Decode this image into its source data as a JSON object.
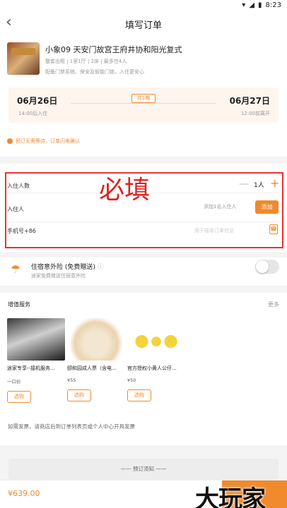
{
  "status": {
    "time": "8:23"
  },
  "nav": {
    "title": "填写订单"
  },
  "hotel": {
    "name": "小象09 天安门故宫王府井协和阳光复式",
    "sub": "整套出租 | 1室1厅 | 2床 | 最多住4人",
    "desc": "配备门禁系统、保安及智能门锁，入住更安心"
  },
  "dates": {
    "checkin": "06月26日",
    "checkin_sub": "14:00后入住",
    "checkout": "06月27日",
    "checkout_sub": "12:00前离开",
    "nights": "共1晚"
  },
  "tip": "预订无需等待，订单闪电确认",
  "form": {
    "guests_label": "入住人数",
    "guests_count": "1人",
    "guest_label": "入住人",
    "guest_hint": "添加1名入住人",
    "add_button": "添加",
    "phone_label": "手机号+86",
    "phone_placeholder": "用于接收订单信息",
    "required_overlay": "必填"
  },
  "insurance": {
    "title": "住宿意外险",
    "free": "(免费赠送)",
    "sub": "途家免费赠送住宿意外险"
  },
  "services": {
    "title": "增值服务",
    "more": "更多",
    "items": [
      {
        "name": "途家专享--接机服务...",
        "price": "一口价",
        "button": "选购"
      },
      {
        "name": "颐和园成人票（含电...",
        "price": "¥55",
        "button": "选购"
      },
      {
        "name": "官方授权小黄人公仔...",
        "price": "¥50",
        "button": "选购"
      }
    ]
  },
  "invoice": "如需发票，请商店后到订单列表页或个人中心开具发票",
  "notice": "预订须知",
  "bottom": {
    "price": "¥639.00"
  },
  "watermark": "大玩家"
}
